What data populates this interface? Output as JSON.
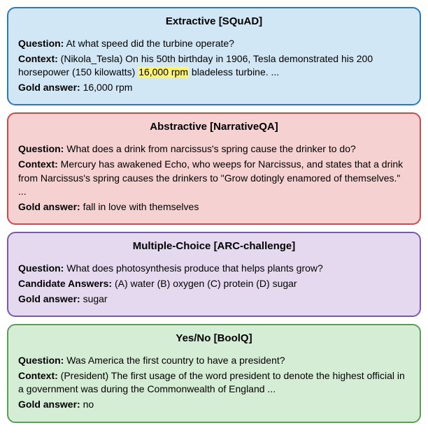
{
  "cards": [
    {
      "title": "Extractive [SQuAD]",
      "question_label": "Question:",
      "question": "At what speed did the turbine operate?",
      "context_label": "Context:",
      "context_pre": "(Nikola_Tesla) On his 50th birthday in 1906, Tesla demonstrated his 200 horsepower (150 kilowatts) ",
      "context_hl": "16,000 rpm",
      "context_post": " bladeless turbine. ...",
      "gold_label": "Gold answer:",
      "gold": "16,000 rpm"
    },
    {
      "title": "Abstractive [NarrativeQA]",
      "question_label": "Question:",
      "question": "What does a drink from narcissus's spring cause the drinker to do?",
      "context_label": "Context:",
      "context": "Mercury has awakened Echo, who weeps for Narcissus, and states that a drink from Narcissus's spring causes the drinkers to \"Grow dotingly enamored of themselves.\" ...",
      "gold_label": "Gold answer:",
      "gold": "fall in love with themselves"
    },
    {
      "title": "Multiple-Choice [ARC-challenge]",
      "question_label": "Question:",
      "question": "What does photosynthesis produce that helps plants grow?",
      "candidate_label": "Candidate Answers:",
      "candidate": "(A) water (B) oxygen (C) protein (D) sugar",
      "gold_label": "Gold answer:",
      "gold": "sugar"
    },
    {
      "title": "Yes/No [BoolQ]",
      "question_label": "Question:",
      "question": "Was America the first country to have a president?",
      "context_label": "Context:",
      "context": "(President) The first usage of the word president to denote the highest official in a government was during the Commonwealth of England ...",
      "gold_label": "Gold answer:",
      "gold": "no"
    }
  ]
}
